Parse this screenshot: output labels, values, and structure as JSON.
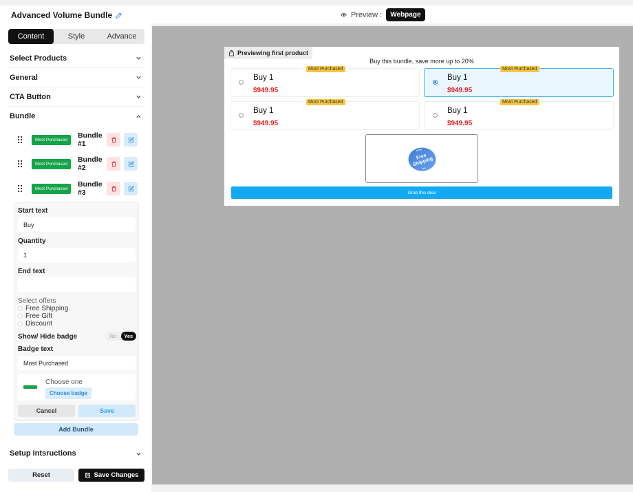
{
  "header": {
    "app_title": "Advanced Volume Bundle",
    "preview_label": "Preview :",
    "preview_mode": "Webpage"
  },
  "sidebar": {
    "tabs": [
      {
        "label": "Content",
        "active": true
      },
      {
        "label": "Style",
        "active": false
      },
      {
        "label": "Advance",
        "active": false
      }
    ],
    "sections": {
      "select_products": "Select Products",
      "general": "General",
      "cta_button": "CTA Button",
      "bundle": "Bundle",
      "setup": "Setup Intsructions"
    },
    "bundles": [
      {
        "badge": "Most Purchased",
        "name": "Bundle #1"
      },
      {
        "badge": "Most Purchased",
        "name": "Bundle #2"
      },
      {
        "badge": "Most Purchased",
        "name": "Bundle #3"
      }
    ],
    "editor": {
      "start_text_label": "Start text",
      "start_text_value": "Buy",
      "quantity_label": "Quantity",
      "quantity_value": "1",
      "end_text_label": "End text",
      "end_text_value": "",
      "select_offers_label": "Select offers",
      "offers": [
        "Free Shipping",
        "Free Gift",
        "Discount"
      ],
      "badge_toggle_label": "Show/ Hide badge",
      "toggle_no": "No",
      "toggle_yes": "Yes",
      "badge_text_label": "Badge text",
      "badge_text_value": "Most Purchased",
      "choose_one": "Choose one",
      "choose_badge": "Choose badge",
      "cancel": "Cancel",
      "save": "Save"
    },
    "add_bundle": "Add Bundle",
    "reset": "Reset",
    "save_changes": "Save Changes"
  },
  "preview": {
    "chip": "Previewing first product",
    "headline": "Buy this bundle, save more up to 20%",
    "offers": [
      {
        "title": "Buy 1",
        "price": "$949.95",
        "badge": "Most Purchased",
        "selected": false
      },
      {
        "title": "Buy 1",
        "price": "$949.95",
        "badge": "Most Purchased",
        "selected": true
      },
      {
        "title": "Buy 1",
        "price": "$949.95",
        "badge": "Most Purchased",
        "selected": false
      },
      {
        "title": "Buy 1",
        "price": "$949.95",
        "badge": "Most Purchased",
        "selected": false
      }
    ],
    "shipping_badge_line1": "Free",
    "shipping_badge_line2": "Shipping",
    "cta": "Grab this deal"
  },
  "colors": {
    "accent": "#13a9f3",
    "badge_green": "#16a34a",
    "badge_yellow": "#f6c544",
    "price_red": "#e32020"
  }
}
